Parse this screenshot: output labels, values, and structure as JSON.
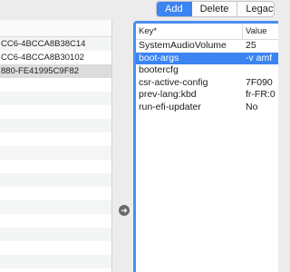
{
  "toolbar": {
    "buttons": [
      {
        "label": "Add",
        "active": true
      },
      {
        "label": "Delete",
        "active": false
      },
      {
        "label": "Legacy",
        "active": false
      }
    ]
  },
  "left_list": {
    "rows": [
      "CC6-4BCCA8B38C14",
      "CC6-4BCCA8B30102",
      "880-FE41995C9F82"
    ],
    "selected_index": 2
  },
  "right_table": {
    "headers": {
      "key": "Key*",
      "value": "Value"
    },
    "rows": [
      {
        "key": "SystemAudioVolume",
        "value": "25"
      },
      {
        "key": "boot-args",
        "value": "-v amf"
      },
      {
        "key": "bootercfg",
        "value": ""
      },
      {
        "key": "csr-active-config",
        "value": "7F090"
      },
      {
        "key": "prev-lang:kbd",
        "value": "fr-FR:0"
      },
      {
        "key": "run-efi-updater",
        "value": "No"
      }
    ],
    "selected_index": 1
  },
  "move_button": {
    "icon": "arrow-right-icon",
    "glyph": "➜"
  },
  "colors": {
    "accent": "#3b84f1",
    "focus_ring": "#4a8ef2"
  }
}
